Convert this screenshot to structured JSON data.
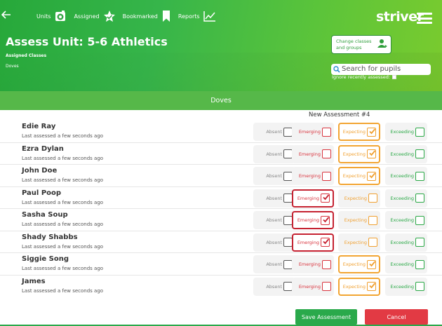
{
  "nav": {
    "units_label": "Units",
    "assigned_label": "Assigned",
    "bookmarked_label": "Bookmarked",
    "reports_label": "Reports",
    "logo_text": "striver"
  },
  "page": {
    "title": "Assess Unit: 5-6 Athletics",
    "subtitle": "Assigned Classes",
    "class_name": "Doves",
    "change_classes_line1": "Change classes",
    "change_classes_line2": "and groups",
    "search_placeholder": "Search for pupils",
    "ignore_label": "Ignore recently assessed:"
  },
  "band": {
    "title": "Doves"
  },
  "assessment": {
    "column_title": "New Assessment #4"
  },
  "option_labels": {
    "absent": "Absent",
    "emerging": "Emerging",
    "expecting": "Expecting",
    "exceeding": "Exceeding"
  },
  "pupils": [
    {
      "name": "Edie Ray",
      "last": "Last assessed a few seconds ago",
      "selected": "expecting"
    },
    {
      "name": "Ezra Dylan",
      "last": "Last assessed a few seconds ago",
      "selected": "expecting"
    },
    {
      "name": "John Doe",
      "last": "Last assessed a few seconds ago",
      "selected": "expecting"
    },
    {
      "name": "Paul Poop",
      "last": "Last assessed a few seconds ago",
      "selected": "emerging"
    },
    {
      "name": "Sasha Soup",
      "last": "Last assessed a few seconds ago",
      "selected": "emerging"
    },
    {
      "name": "Shady Shabbs",
      "last": "Last assessed a few seconds ago",
      "selected": "emerging"
    },
    {
      "name": "Siggie Song",
      "last": "Last assessed a few seconds ago",
      "selected": "expecting"
    },
    {
      "name": "James",
      "last": "Last assessed a few seconds ago",
      "selected": "expecting"
    }
  ],
  "footer": {
    "save_label": "Save Assessment",
    "cancel_label": "Cancel"
  },
  "colors": {
    "brand_green": "#36b54a",
    "emerging_red": "#d9343e",
    "expecting_orange": "#f0a030",
    "exceeding_green": "#2aa846",
    "cancel_red": "#e23a44"
  }
}
